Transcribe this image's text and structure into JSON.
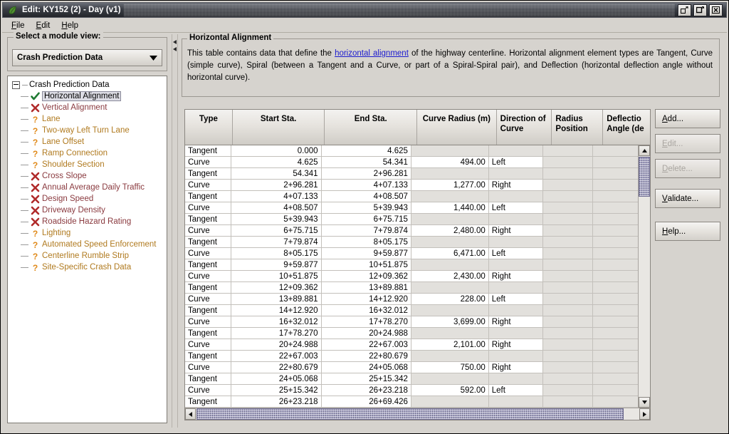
{
  "window": {
    "title": "Edit: KY152 (2) - Day (v1)",
    "icon": "leaf-icon",
    "controls": {
      "restore_label": "restore-icon",
      "maximize_label": "maximize-icon",
      "close_label": "close-icon"
    }
  },
  "menubar": {
    "items": [
      {
        "label": "File",
        "mnemonic": "F"
      },
      {
        "label": "Edit",
        "mnemonic": "E"
      },
      {
        "label": "Help",
        "mnemonic": "H"
      }
    ]
  },
  "sidebar": {
    "group_legend": "Select a module view:",
    "combo": {
      "value": "Crash Prediction Data",
      "icon": "chevron-down-icon"
    },
    "tree": {
      "root_label": "Crash Prediction Data",
      "items": [
        {
          "label": "Horizontal Alignment",
          "status": "ok",
          "icon": "check-icon",
          "selected": true
        },
        {
          "label": "Vertical Alignment",
          "status": "err",
          "icon": "x-icon",
          "selected": false
        },
        {
          "label": "Lane",
          "status": "warn",
          "icon": "question-icon",
          "selected": false
        },
        {
          "label": "Two-way Left Turn Lane",
          "status": "warn",
          "icon": "question-icon",
          "selected": false
        },
        {
          "label": "Lane Offset",
          "status": "warn",
          "icon": "question-icon",
          "selected": false
        },
        {
          "label": "Ramp Connection",
          "status": "warn",
          "icon": "question-icon",
          "selected": false
        },
        {
          "label": "Shoulder Section",
          "status": "warn",
          "icon": "question-icon",
          "selected": false
        },
        {
          "label": "Cross Slope",
          "status": "err",
          "icon": "x-icon",
          "selected": false
        },
        {
          "label": "Annual Average Daily Traffic",
          "status": "err",
          "icon": "x-icon",
          "selected": false
        },
        {
          "label": "Design Speed",
          "status": "err",
          "icon": "x-icon",
          "selected": false
        },
        {
          "label": "Driveway Density",
          "status": "err",
          "icon": "x-icon",
          "selected": false
        },
        {
          "label": "Roadside Hazard Rating",
          "status": "err",
          "icon": "x-icon",
          "selected": false
        },
        {
          "label": "Lighting",
          "status": "warn",
          "icon": "question-icon",
          "selected": false
        },
        {
          "label": "Automated Speed Enforcement",
          "status": "warn",
          "icon": "question-icon",
          "selected": false
        },
        {
          "label": "Centerline Rumble Strip",
          "status": "warn",
          "icon": "question-icon",
          "selected": false
        },
        {
          "label": "Site-Specific Crash Data",
          "status": "warn",
          "icon": "question-icon",
          "selected": false
        }
      ]
    }
  },
  "main": {
    "panel_legend": "Horizontal Alignment",
    "description": {
      "before_link": "This table contains data that define the ",
      "link": "horizontal alignment",
      "after_link": " of the highway centerline. Horizontal alignment element types are Tangent, Curve (simple curve), Spiral (between a Tangent and a Curve, or part of a Spiral-Spiral pair), and Deflection (horizontal deflection angle without horizontal curve)."
    },
    "table": {
      "columns": [
        "Type",
        "Start Sta.",
        "End Sta.",
        "Curve Radius (m)",
        "Direction of Curve",
        "Radius Position",
        "Deflectio Angle (de"
      ],
      "rows": [
        {
          "type": "Tangent",
          "start": "0.000",
          "end": "4.625",
          "radius": "",
          "direction": ""
        },
        {
          "type": "Curve",
          "start": "4.625",
          "end": "54.341",
          "radius": "494.00",
          "direction": "Left"
        },
        {
          "type": "Tangent",
          "start": "54.341",
          "end": "2+96.281",
          "radius": "",
          "direction": ""
        },
        {
          "type": "Curve",
          "start": "2+96.281",
          "end": "4+07.133",
          "radius": "1,277.00",
          "direction": "Right"
        },
        {
          "type": "Tangent",
          "start": "4+07.133",
          "end": "4+08.507",
          "radius": "",
          "direction": ""
        },
        {
          "type": "Curve",
          "start": "4+08.507",
          "end": "5+39.943",
          "radius": "1,440.00",
          "direction": "Left"
        },
        {
          "type": "Tangent",
          "start": "5+39.943",
          "end": "6+75.715",
          "radius": "",
          "direction": ""
        },
        {
          "type": "Curve",
          "start": "6+75.715",
          "end": "7+79.874",
          "radius": "2,480.00",
          "direction": "Right"
        },
        {
          "type": "Tangent",
          "start": "7+79.874",
          "end": "8+05.175",
          "radius": "",
          "direction": ""
        },
        {
          "type": "Curve",
          "start": "8+05.175",
          "end": "9+59.877",
          "radius": "6,471.00",
          "direction": "Left"
        },
        {
          "type": "Tangent",
          "start": "9+59.877",
          "end": "10+51.875",
          "radius": "",
          "direction": ""
        },
        {
          "type": "Curve",
          "start": "10+51.875",
          "end": "12+09.362",
          "radius": "2,430.00",
          "direction": "Right"
        },
        {
          "type": "Tangent",
          "start": "12+09.362",
          "end": "13+89.881",
          "radius": "",
          "direction": ""
        },
        {
          "type": "Curve",
          "start": "13+89.881",
          "end": "14+12.920",
          "radius": "228.00",
          "direction": "Left"
        },
        {
          "type": "Tangent",
          "start": "14+12.920",
          "end": "16+32.012",
          "radius": "",
          "direction": ""
        },
        {
          "type": "Curve",
          "start": "16+32.012",
          "end": "17+78.270",
          "radius": "3,699.00",
          "direction": "Right"
        },
        {
          "type": "Tangent",
          "start": "17+78.270",
          "end": "20+24.988",
          "radius": "",
          "direction": ""
        },
        {
          "type": "Curve",
          "start": "20+24.988",
          "end": "22+67.003",
          "radius": "2,101.00",
          "direction": "Right"
        },
        {
          "type": "Tangent",
          "start": "22+67.003",
          "end": "22+80.679",
          "radius": "",
          "direction": ""
        },
        {
          "type": "Curve",
          "start": "22+80.679",
          "end": "24+05.068",
          "radius": "750.00",
          "direction": "Right"
        },
        {
          "type": "Tangent",
          "start": "24+05.068",
          "end": "25+15.342",
          "radius": "",
          "direction": ""
        },
        {
          "type": "Curve",
          "start": "25+15.342",
          "end": "26+23.218",
          "radius": "592.00",
          "direction": "Left"
        },
        {
          "type": "Tangent",
          "start": "26+23.218",
          "end": "26+69.426",
          "radius": "",
          "direction": ""
        }
      ]
    },
    "buttons": [
      {
        "label": "Add...",
        "mnemonic": "A",
        "enabled": true
      },
      {
        "label": "Edit...",
        "mnemonic": "E",
        "enabled": false
      },
      {
        "label": "Delete...",
        "mnemonic": "D",
        "enabled": false
      },
      {
        "label": "Validate...",
        "mnemonic": "V",
        "enabled": true
      },
      {
        "label": "Help...",
        "mnemonic": "H",
        "enabled": true
      }
    ]
  },
  "colors": {
    "status_ok": "#1f7a32",
    "status_error": "#b02a2a",
    "status_warn": "#e08a1a",
    "link": "#1a1ad0",
    "selection": "#dcdce4",
    "scrollbar_thumb": "#a7a5c4",
    "panel_bg": "#d6d3ce"
  }
}
